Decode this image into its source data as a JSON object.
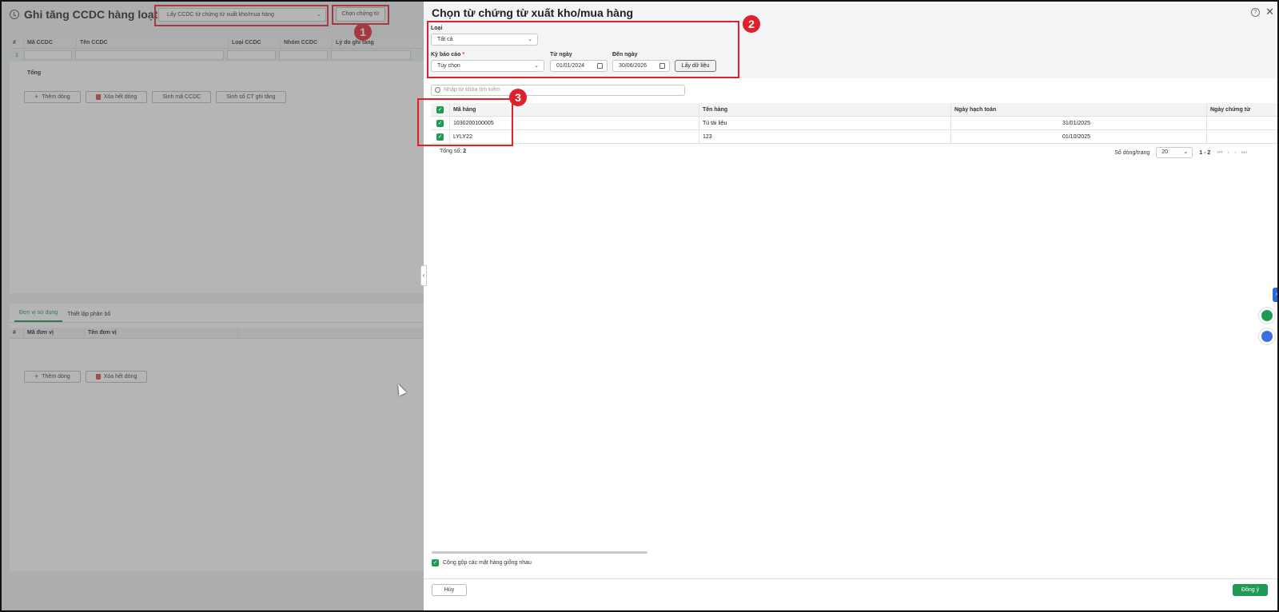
{
  "background": {
    "title": "Ghi tăng CCDC hàng loạt",
    "source_select": "Lấy CCDC từ chứng từ xuất kho/mua hàng",
    "choose_button": "Chọn chứng từ",
    "grid_headers": [
      "#",
      "Mã CCDC",
      "Tên CCDC",
      "Loại CCDC",
      "Nhóm CCDC",
      "Lý do ghi tăng"
    ],
    "row_number": "1",
    "total_label": "Tổng",
    "buttons": {
      "add_row": "Thêm dòng",
      "delete_all": "Xóa hết dòng",
      "gen_code": "Sinh mã CCDC",
      "gen_doc": "Sinh số CT ghi tăng"
    },
    "tabs": [
      "Đơn vị sử dụng",
      "Thiết lập phân bổ"
    ],
    "lower_headers": [
      "#",
      "Mã đơn vị",
      "Tên đơn vị"
    ],
    "lower_buttons": {
      "add_row": "Thêm dòng",
      "delete_all": "Xóa hết dòng"
    }
  },
  "badges": [
    "1",
    "2",
    "3"
  ],
  "panel": {
    "title": "Chọn từ chứng từ xuất kho/mua hàng",
    "type_label": "Loại",
    "type_value": "Tất cả",
    "period_label": "Kỳ báo cáo",
    "period_required": "*",
    "period_value": "Tùy chọn",
    "from_label": "Từ ngày",
    "from_value": "01/01/2024",
    "to_label": "Đến ngày",
    "to_value": "30/06/2026",
    "fetch_button": "Lấy dữ liệu",
    "search_placeholder": "Nhập từ khóa tìm kiếm",
    "columns": [
      "Mã hàng",
      "Tên hàng",
      "Ngày hạch toán",
      "Ngày chứng từ"
    ],
    "rows": [
      {
        "code": "1030200100005",
        "name": "Tủ tài liệu",
        "date": "31/01/2025"
      },
      {
        "code": "LYLY22",
        "name": "123",
        "date": "01/10/2025"
      }
    ],
    "total_label": "Tổng số:",
    "total_value": "2",
    "rows_per_page_label": "Số dòng/trang",
    "rows_per_page": "20",
    "page_range": "1 - 2",
    "merge_label": "Cộng gộp các mặt hàng giống nhau",
    "cancel_button": "Hủy",
    "ok_button": "Đồng ý"
  },
  "colors": {
    "accent": "#1f9a55",
    "highlight": "#e0202a"
  }
}
